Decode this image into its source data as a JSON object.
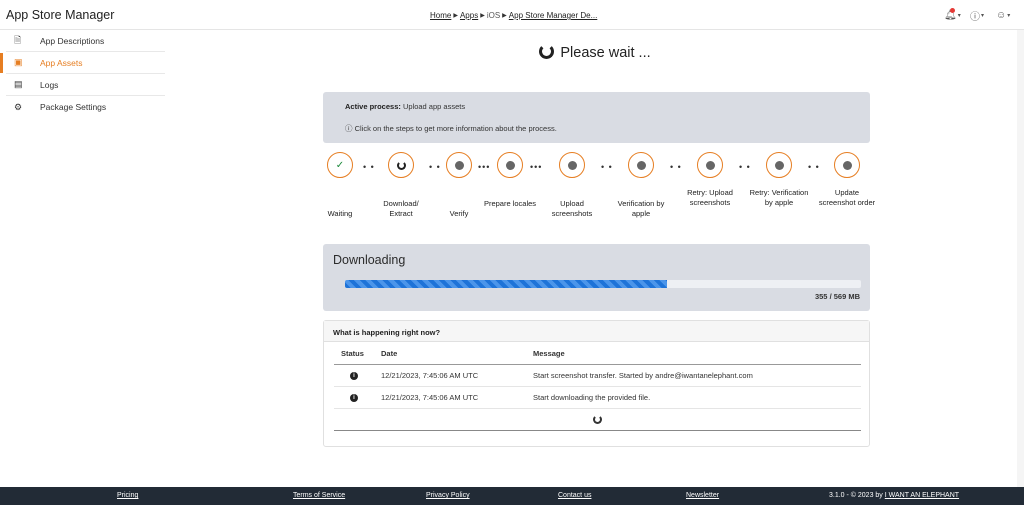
{
  "header": {
    "app_title": "App Store Manager",
    "breadcrumb": {
      "home": "Home",
      "apps": "Apps",
      "platform": "iOS",
      "current": "App Store Manager De..."
    }
  },
  "sidebar": {
    "items": [
      {
        "label": "App Descriptions",
        "icon": "document-icon",
        "active": false
      },
      {
        "label": "App Assets",
        "icon": "image-icon",
        "active": true
      },
      {
        "label": "Logs",
        "icon": "log-icon",
        "active": false
      },
      {
        "label": "Package Settings",
        "icon": "gear-icon",
        "active": false
      }
    ]
  },
  "main": {
    "wait_title": "Please wait ...",
    "info": {
      "active_label": "Active process:",
      "active_value": "Upload app assets",
      "hint": "Click on the steps to get more information about the process."
    },
    "steps": [
      {
        "label": "Waiting",
        "state": "done"
      },
      {
        "label": "Download/ Extract",
        "state": "running"
      },
      {
        "label": "Verify",
        "state": "pending"
      },
      {
        "label": "Prepare locales",
        "state": "pending"
      },
      {
        "label": "Upload screenshots",
        "state": "pending"
      },
      {
        "label": "Verification by apple",
        "state": "pending"
      },
      {
        "label": "Retry: Upload screenshots",
        "state": "pending"
      },
      {
        "label": "Retry: Verification by apple",
        "state": "pending"
      },
      {
        "label": "Update screenshot order",
        "state": "pending"
      }
    ],
    "download": {
      "title": "Downloading",
      "progress_fraction": 0.624,
      "count": "355 / 569 MB"
    },
    "happening": {
      "title": "What is happening right now?",
      "columns": [
        "Status",
        "Date",
        "Message"
      ],
      "rows": [
        {
          "date": "12/21/2023, 7:45:06 AM UTC",
          "message": "Start screenshot transfer. Started by andre@iwantanelephant.com"
        },
        {
          "date": "12/21/2023, 7:45:06 AM UTC",
          "message": "Start downloading the provided file."
        }
      ]
    }
  },
  "footer": {
    "pricing": "Pricing",
    "terms": "Terms of Service",
    "privacy": "Privacy Policy",
    "contact": "Contact us",
    "newsletter": "Newsletter",
    "copyright": "3.1.0 - © 2023 by",
    "company": "I WANT AN ELEPHANT"
  },
  "colors": {
    "accent": "#e67e22",
    "progress": "#1e73d8",
    "footer_bg": "#222b36",
    "panel_bg": "#d9dce3"
  }
}
